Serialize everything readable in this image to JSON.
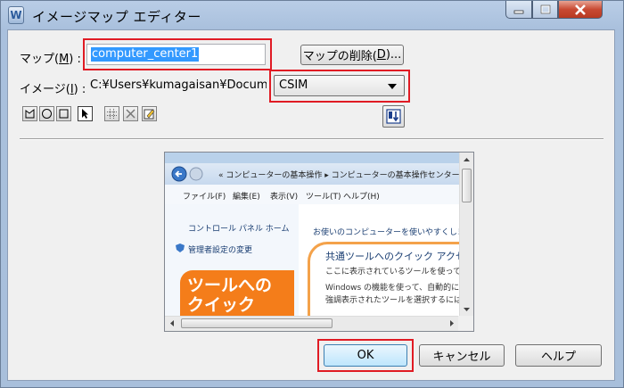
{
  "window": {
    "title": "イメージマップ エディター",
    "app_icon_glyph": "W"
  },
  "form": {
    "map_label": "マップ(",
    "map_mnemonic": "M",
    "map_label_end": ") :",
    "map_value": "computer_center1",
    "delete_map_button": "マップの削除(",
    "delete_map_mnemonic": "D",
    "delete_map_end": ")...",
    "image_label": "イメージ(",
    "image_mnemonic": "I",
    "image_label_end": ") :",
    "image_path": "C:¥Users¥kumagaisan¥Docume",
    "map_type_selected": "CSIM"
  },
  "toolbar": {
    "tools": [
      "polygon-tool-icon",
      "circle-tool-icon",
      "rectangle-tool-icon",
      "pointer-tool-icon"
    ],
    "tools2": [
      "grid-tool-icon",
      "delete-shape-icon",
      "edit-shape-icon"
    ],
    "order_button_icon": "order-arrow-icon"
  },
  "preview": {
    "menu": [
      "ファイル(F)",
      "編集(E)",
      "表示(V)",
      "ツール(T)",
      "ヘルプ(H)"
    ],
    "address": "« コンピューターの基本操作 ▸ コンピューターの基本操作センター",
    "left_links": [
      "コントロール パネル ホーム",
      "管理者設定の変更"
    ],
    "right_heading": "お使いのコンピューターを使いやすくします",
    "panel_title": "共通ツールへのクイック アクセス",
    "panel_line1": "ここに表示されているツールを使って、",
    "panel_line2": "Windows の機能を使って、自動的に",
    "panel_line3": "強調表示されたツールを選択するには、",
    "card_line1": "ツールへの",
    "card_line2": "クイック"
  },
  "buttons": {
    "ok": "OK",
    "cancel": "キャンセル",
    "help": "ヘルプ"
  },
  "colors": {
    "highlight_red": "#e01b24",
    "selection_blue": "#3399ff",
    "card_orange": "#f47d1a"
  }
}
